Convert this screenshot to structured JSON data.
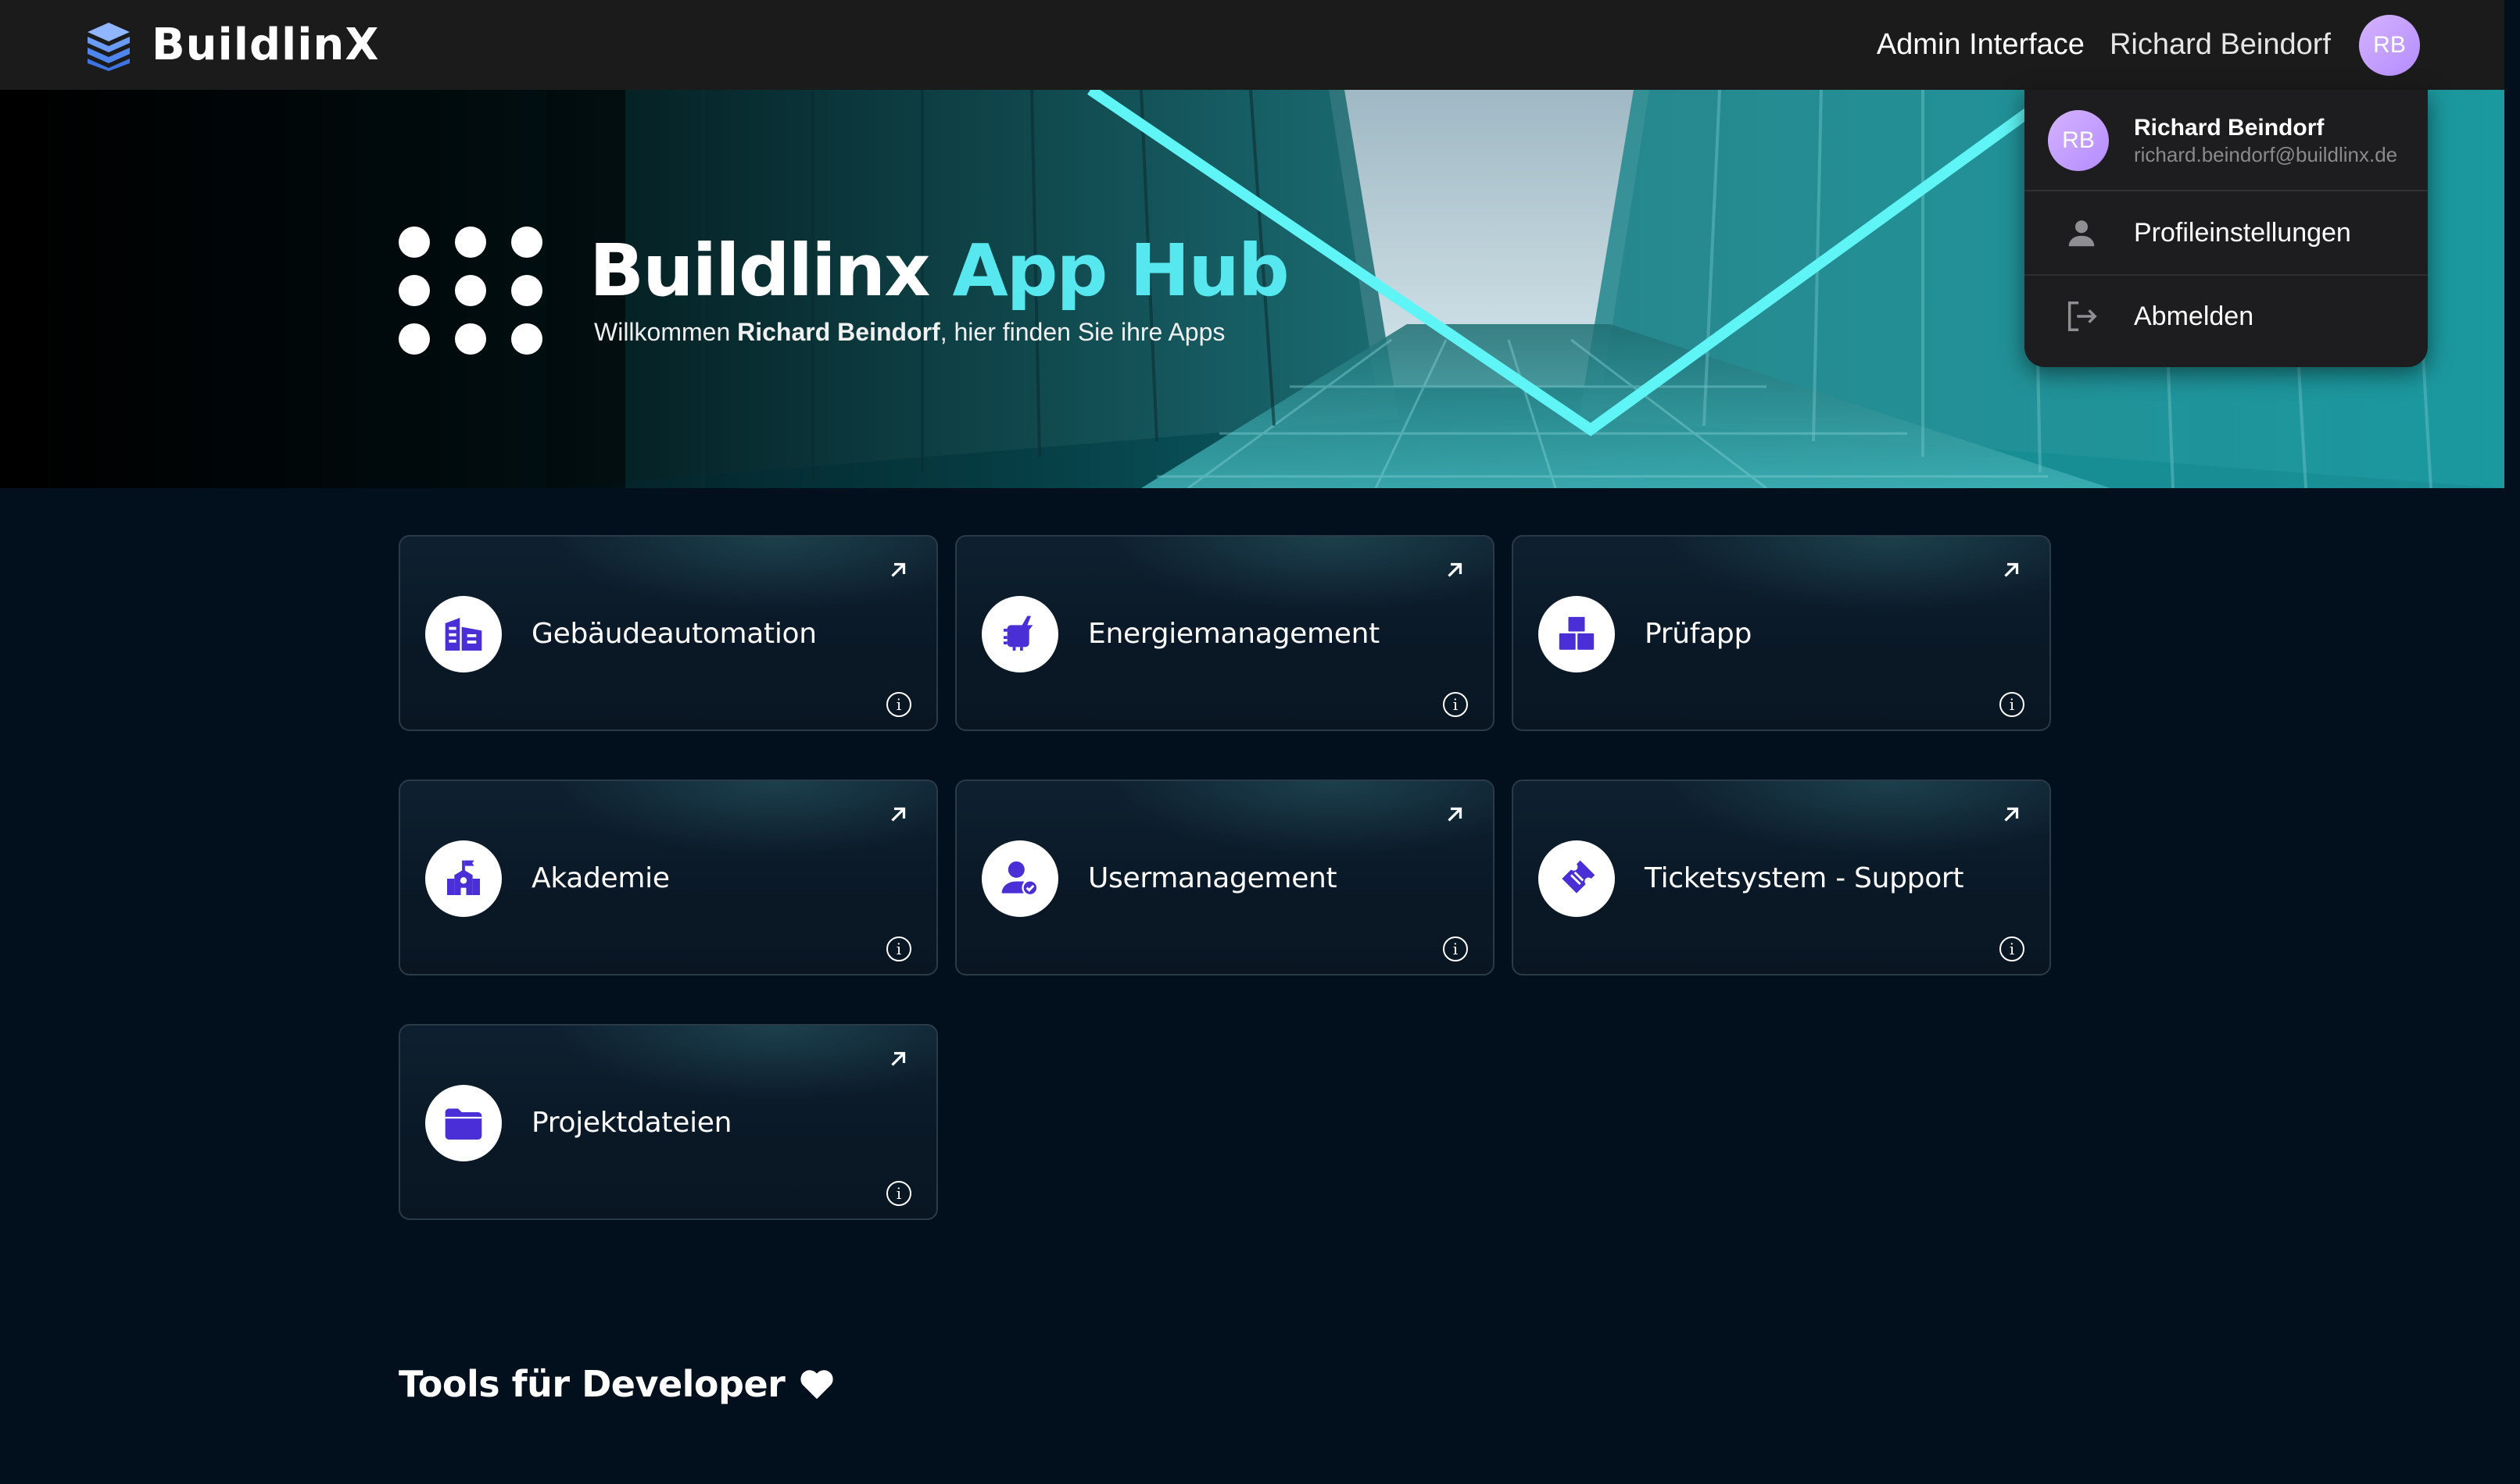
{
  "brand": {
    "name": "BuildlinX",
    "logo_icon": "layers-logo-icon"
  },
  "topbar": {
    "admin_link": "Admin Interface",
    "user_name": "Richard Beindorf",
    "avatar_initials": "RB"
  },
  "hero": {
    "title_main": "Buildlinx",
    "title_accent": "App Hub",
    "subtitle_prefix": "Willkommen",
    "subtitle_name": "Richard Beindorf",
    "subtitle_suffix": ", hier finden Sie ihre Apps",
    "accent_color": "#57e7ee"
  },
  "user_menu": {
    "avatar_initials": "RB",
    "name": "Richard Beindorf",
    "email": "richard.beindorf@buildlinx.de",
    "items": [
      {
        "label": "Profileinstellungen",
        "icon": "person-icon"
      },
      {
        "label": "Abmelden",
        "icon": "logout-icon"
      }
    ]
  },
  "apps": [
    {
      "label": "Gebäudeautomation",
      "icon": "building-icon"
    },
    {
      "label": "Energiemanagement",
      "icon": "energy-chip-icon"
    },
    {
      "label": "Prüfapp",
      "icon": "boxes-icon"
    },
    {
      "label": "Akademie",
      "icon": "school-icon"
    },
    {
      "label": "Usermanagement",
      "icon": "user-check-icon"
    },
    {
      "label": "Ticketsystem - Support",
      "icon": "ticket-icon"
    },
    {
      "label": "Projektdateien",
      "icon": "folder-icon"
    }
  ],
  "app_icon_color": "#4a2fd6",
  "sections": {
    "developer_tools": "Tools für Developer"
  }
}
